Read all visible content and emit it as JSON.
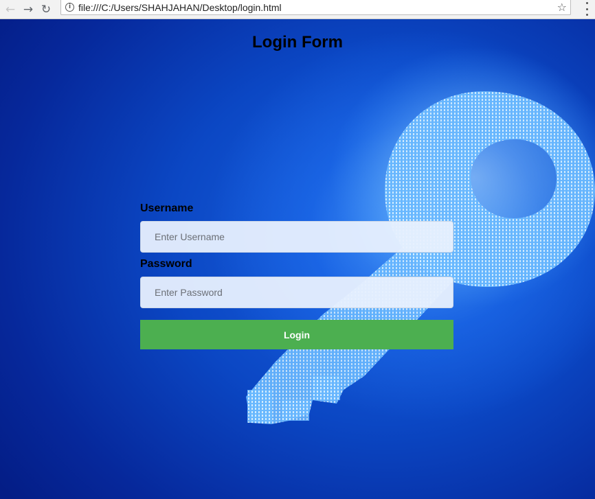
{
  "browser": {
    "url": "file:///C:/Users/SHAHJAHAN/Desktop/login.html",
    "back_icon": "arrow-left-icon",
    "forward_icon": "arrow-right-icon",
    "reload_icon": "reload-icon",
    "info_icon": "info-icon",
    "bookmark_icon": "star-icon",
    "menu_icon": "more-vertical-icon"
  },
  "page": {
    "title": "Login Form",
    "username": {
      "label": "Username",
      "placeholder": "Enter Username",
      "value": ""
    },
    "password": {
      "label": "Password",
      "placeholder": "Enter Password",
      "value": ""
    },
    "login_button": "Login",
    "colors": {
      "background": "#0b47c4",
      "button": "#4caf50",
      "input": "#e8f0fe"
    }
  }
}
